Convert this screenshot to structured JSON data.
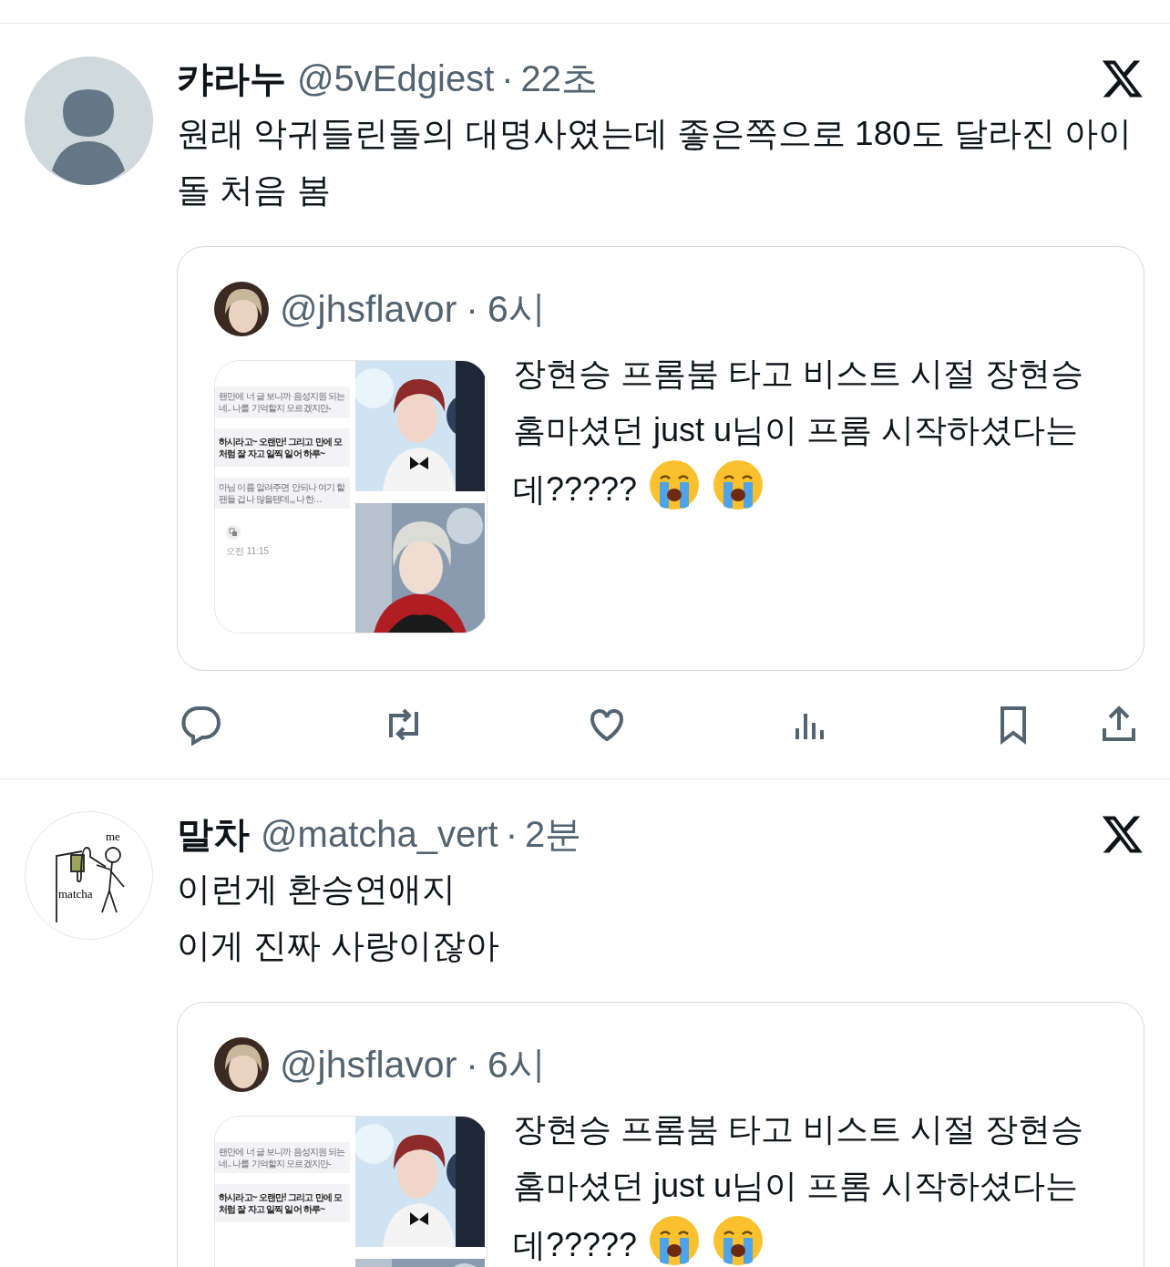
{
  "tweets": [
    {
      "author": {
        "name": "캬라누",
        "handle": "@5vEdgiest",
        "avatar": {
          "kind": "default"
        }
      },
      "separator": "·",
      "time": "22초",
      "text": "원래 악귀들린돌의 대명사였는데 좋은쪽으로 180도 달라진 아이돌 처음 봄",
      "actions_visible": true,
      "quote": {
        "handle": "@jhsflavor",
        "separator": "·",
        "time": "6시",
        "text": "장현승 프롬붐 타고 비스트 시절 장현승 홈마셨던 just u님이 프롬 시작하셨다는데?????",
        "emojis": [
          {
            "kind": "crying"
          },
          {
            "kind": "crying"
          }
        ],
        "media": {
          "chat": [
            {
              "kind": "quoted",
              "text": "랜만에 너 글 보니까 음성지원 되는 네.. 나를 기억할지 모르겠지만-"
            },
            {
              "kind": "message",
              "text": "하시라고~ 오랜만! 그리고 만에 모처럼 잘 자고 일찍 일어 하루~"
            },
            {
              "kind": "quoted",
              "text": "마님 이름 알려주면 안되나 여기 할 팬들 겁나 많을텐데,,, 나한…"
            }
          ],
          "chat_time": "오전 11:15"
        }
      }
    },
    {
      "author": {
        "name": "말차",
        "handle": "@matcha_vert",
        "avatar": {
          "kind": "drawing",
          "labels": [
            "me",
            "matcha"
          ]
        }
      },
      "separator": "·",
      "time": "2분",
      "text": "이런게 환승연애지\n이게 진짜 사랑이잖아",
      "actions_visible": false,
      "quote": {
        "handle": "@jhsflavor",
        "separator": "·",
        "time": "6시",
        "text": "장현승 프롬붐 타고 비스트 시절 장현승 홈마셨던 just u님이 프롬 시작하셨다는데?????",
        "emojis": [
          {
            "kind": "crying"
          },
          {
            "kind": "crying"
          }
        ],
        "media": {
          "chat": [
            {
              "kind": "quoted",
              "text": "랜만에 너 글 보니까 음성지원 되는 네.. 나를 기억할지 모르겠지만-"
            },
            {
              "kind": "message",
              "text": "하시라고~ 오랜만! 그리고 만에 모처럼 잘 자고 일찍 일어 하루~"
            }
          ]
        }
      }
    }
  ]
}
